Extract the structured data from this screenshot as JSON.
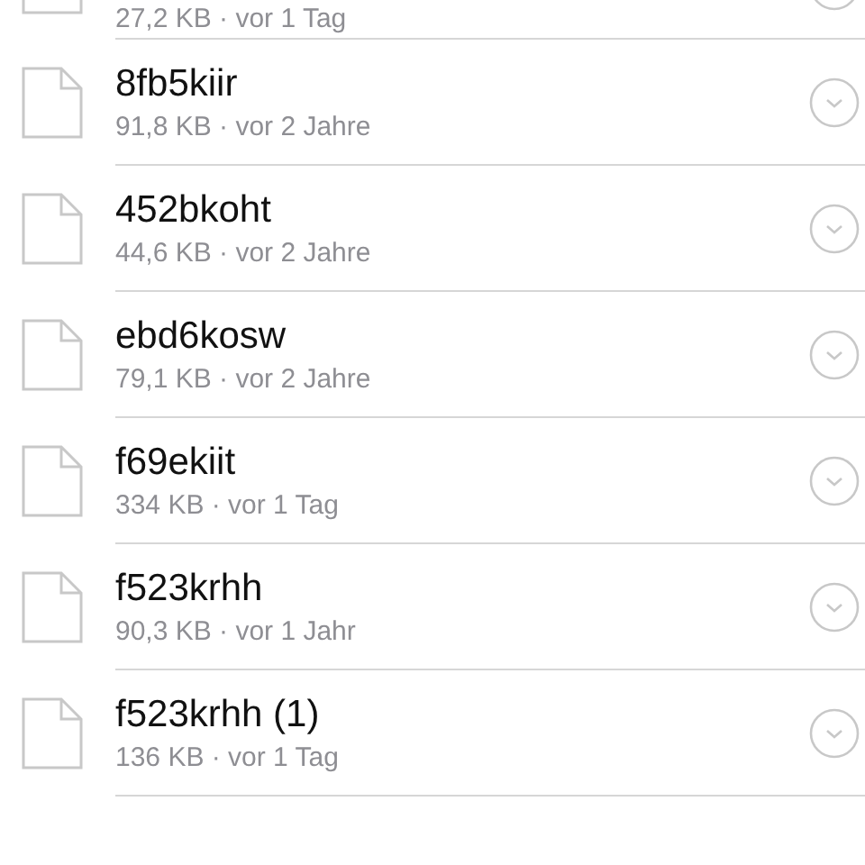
{
  "files": [
    {
      "meta": "27,2 KB · vor 1 Tag",
      "partial": true
    },
    {
      "name": "8fb5kiir",
      "meta": "91,8 KB · vor 2 Jahre",
      "partial": false
    },
    {
      "name": "452bkoht",
      "meta": "44,6 KB · vor 2 Jahre",
      "partial": false
    },
    {
      "name": "ebd6kosw",
      "meta": "79,1 KB · vor 2 Jahre",
      "partial": false
    },
    {
      "name": "f69ekiit",
      "meta": "334 KB · vor 1 Tag",
      "partial": false
    },
    {
      "name": "f523krhh",
      "meta": "90,3 KB · vor 1 Jahr",
      "partial": false
    },
    {
      "name": "f523krhh (1)",
      "meta": "136 KB · vor 1 Tag",
      "partial": false
    }
  ]
}
